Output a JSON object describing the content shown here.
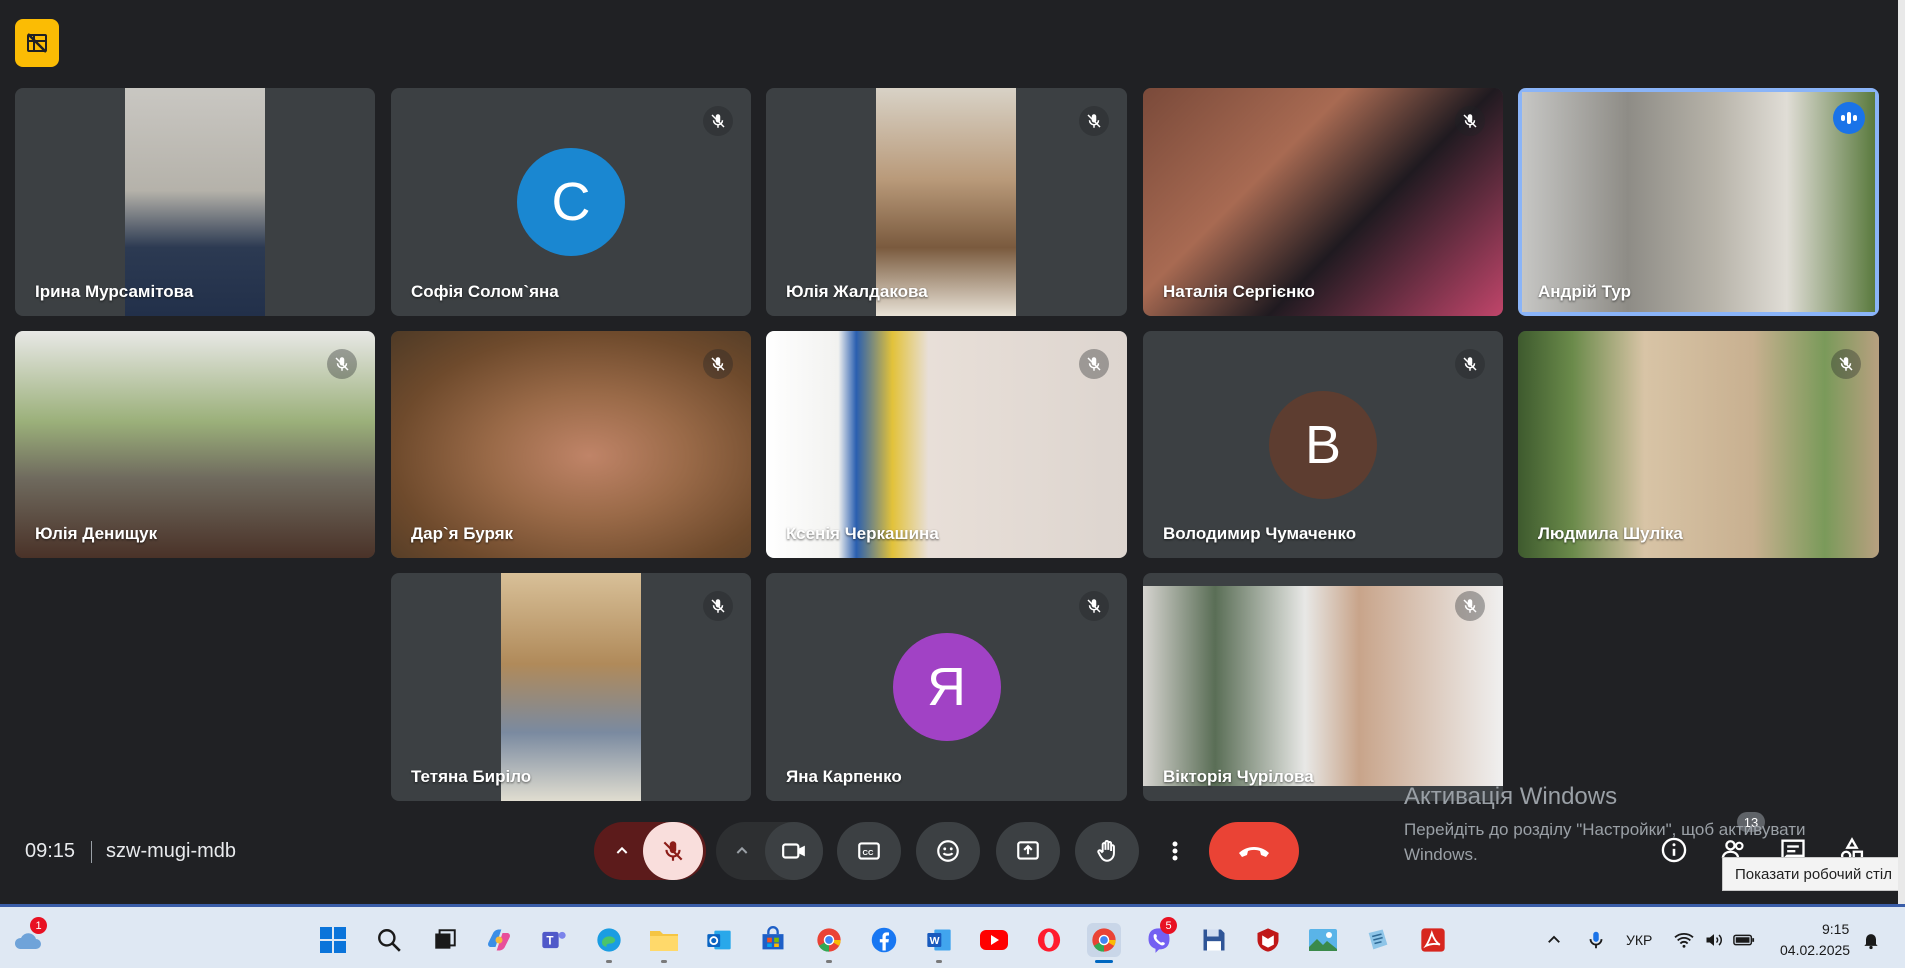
{
  "meeting": {
    "time": "09:15",
    "code": "szw-mugi-mdb",
    "participant_count": "13"
  },
  "participants": [
    {
      "name": "Ірина Мурсамітова",
      "video": true,
      "muted": false
    },
    {
      "name": "Софія Солом`яна",
      "video": false,
      "avatar": "С",
      "avatar_color": "#1a87d1",
      "muted": true
    },
    {
      "name": "Юлія Жалдакова",
      "video": true,
      "muted": true
    },
    {
      "name": "Наталія Сергієнко",
      "video": true,
      "muted": true
    },
    {
      "name": "Андрій Тур",
      "video": true,
      "muted": false,
      "speaking": true
    },
    {
      "name": "Юлія Денищук",
      "video": true,
      "muted": true
    },
    {
      "name": "Дар`я Буряк",
      "video": true,
      "muted": true
    },
    {
      "name": "Ксенія Черкашина",
      "video": true,
      "muted": true
    },
    {
      "name": "Володимир Чумаченко",
      "video": false,
      "avatar": "В",
      "avatar_color": "#5d3d30",
      "muted": true
    },
    {
      "name": "Людмила Шуліка",
      "video": true,
      "muted": true
    },
    {
      "name": "Тетяна Бирiло",
      "video": true,
      "muted": true
    },
    {
      "name": "Яна Карпенко",
      "video": false,
      "avatar": "Я",
      "avatar_color": "#a142c5",
      "muted": true
    },
    {
      "name": "Вікторія Чурілова",
      "video": true,
      "muted": true
    }
  ],
  "overlay": {
    "activation_title": "Активація Windows",
    "activation_text": "Перейдіть до розділу \"Настройки\", щоб активувати Windows.",
    "tooltip": "Показати робочий стіл"
  },
  "taskbar": {
    "weather_badge": "1",
    "viber_badge": "5",
    "language": "УКР",
    "time": "9:15",
    "date": "04.02.2025"
  },
  "colors": {
    "background": "#202124",
    "tile": "#3c4043",
    "hangup": "#ea4335",
    "mic_off": "#f9dedc",
    "speaking": "#1a73e8",
    "toggle": "#fbbc04"
  },
  "icons": [
    "tile-toggle-icon",
    "mic-off-icon",
    "camera-icon",
    "captions-icon",
    "emoji-icon",
    "present-icon",
    "raise-hand-icon",
    "more-icon",
    "hangup-icon",
    "info-icon",
    "people-icon",
    "chat-icon",
    "activities-icon"
  ]
}
